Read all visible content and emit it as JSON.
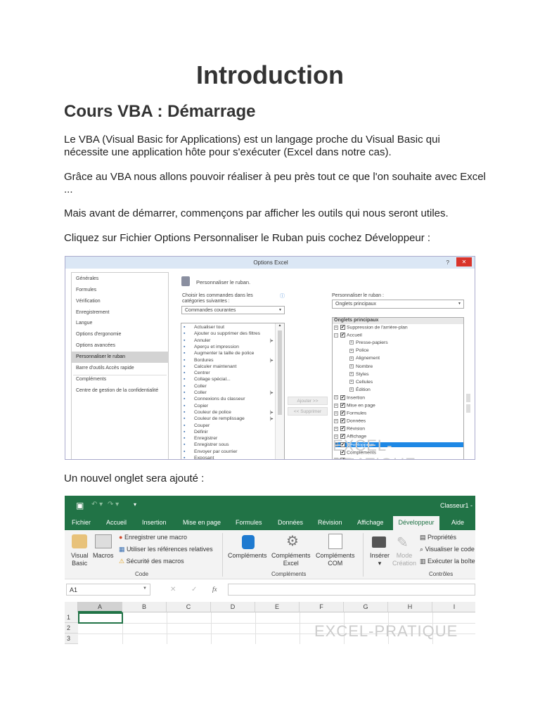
{
  "title": "Introduction",
  "subtitle": "Cours VBA : Démarrage",
  "paragraphs": [
    "Le VBA (Visual Basic for Applications) est un langage proche du Visual Basic qui nécessite une application hôte pour s'exécuter (Excel dans notre cas).",
    "Grâce au VBA nous allons pouvoir réaliser à peu près tout ce que l'on souhaite avec Excel ...",
    "Mais avant de démarrer, commençons par afficher les outils qui nous seront utiles.",
    "Cliquez sur Fichier  Options  Personnaliser le Ruban puis cochez Développeur :",
    "Un nouvel onglet sera ajouté :"
  ],
  "dialog": {
    "title": "Options Excel",
    "help": "?",
    "close": "✕",
    "left_items": [
      "Générales",
      "Formules",
      "Vérification",
      "Enregistrement",
      "Langue",
      "Options d'ergonomie",
      "Options avancées",
      "Personnaliser le ruban",
      "Barre d'outils Accès rapide",
      "Compléments",
      "Centre de gestion de la confidentialité"
    ],
    "header": "Personnaliser le ruban.",
    "choose_label_1": "Choisir les commandes dans les",
    "choose_label_2": "catégories suivantes :",
    "choose_value": "Commandes courantes",
    "commands": [
      "Actualiser tout",
      "Ajouter ou supprimer des filtres",
      "Annuler",
      "Aperçu et impression",
      "Augmenter la taille de police",
      "Bordures",
      "Calculer maintenant",
      "Centrer",
      "Collage spécial...",
      "Coller",
      "Coller",
      "Connexions du classeur",
      "Copier",
      "Couleur de police",
      "Couleur de remplissage",
      "Couper",
      "Définir",
      "Enregistrer",
      "Enregistrer sous",
      "Envoyer par courrier",
      "Exposant"
    ],
    "add_button": "Ajouter >>",
    "remove_button": "<< Supprimer",
    "ribbon_label": "Personnaliser le ruban :",
    "ribbon_value": "Onglets principaux",
    "tree_header": "Onglets principaux",
    "tree": [
      "Suppression de l'arrière-plan",
      "Accueil",
      "Presse-papiers",
      "Police",
      "Alignement",
      "Nombre",
      "Styles",
      "Cellules",
      "Édition",
      "Insertion",
      "Mise en page",
      "Formules",
      "Données",
      "Révision",
      "Affichage",
      "Développeur",
      "Compléments",
      "Aide"
    ],
    "watermark": "EXCEL-PRATIQUE"
  },
  "excel": {
    "window_title": "Classeur1  -",
    "tabs": [
      "Fichier",
      "Accueil",
      "Insertion",
      "Mise en page",
      "Formules",
      "Données",
      "Révision",
      "Affichage",
      "Développeur",
      "Aide"
    ],
    "code": {
      "visual_basic_1": "Visual",
      "visual_basic_2": "Basic",
      "macros": "Macros",
      "record": "Enregistrer une macro",
      "relative": "Utiliser les références relatives",
      "security": "Sécurité des macros",
      "group": "Code"
    },
    "addins": {
      "a1": "Compléments",
      "a2_1": "Compléments",
      "a2_2": "Excel",
      "a3_1": "Compléments",
      "a3_2": "COM",
      "group": "Compléments"
    },
    "controls": {
      "insert": "Insérer",
      "mode_1": "Mode",
      "mode_2": "Création",
      "props": "Propriétés",
      "view_code": "Visualiser le code",
      "run_dialog": "Exécuter la boîte",
      "group": "Contrôles"
    },
    "name_box": "A1",
    "fx": "fx",
    "columns": [
      "A",
      "B",
      "C",
      "D",
      "E",
      "F",
      "G",
      "H",
      "I"
    ],
    "rows": [
      "1",
      "2",
      "3"
    ],
    "watermark": "EXCEL-PRATIQUE"
  }
}
